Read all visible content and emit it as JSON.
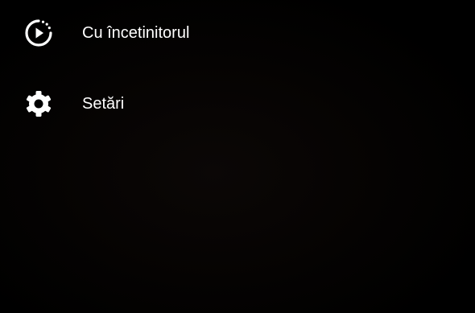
{
  "menu": {
    "items": [
      {
        "label": "Cu încetinitorul",
        "icon": "slow-motion-icon"
      },
      {
        "label": "Setări",
        "icon": "settings-gear-icon"
      }
    ]
  },
  "colors": {
    "background": "#000000",
    "text": "#ffffff"
  }
}
